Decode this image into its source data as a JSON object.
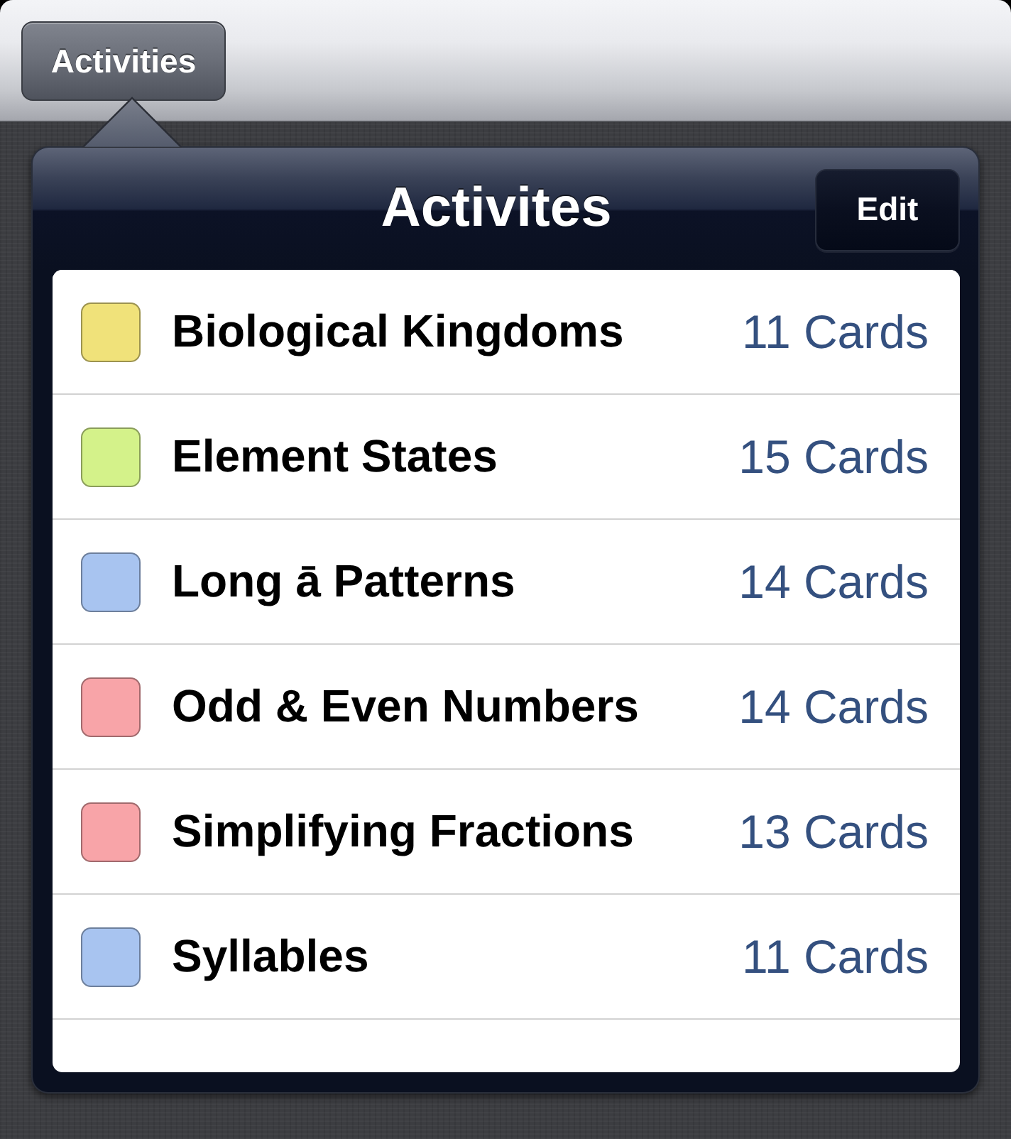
{
  "toolbar": {
    "button": "Activities"
  },
  "popover": {
    "title": "Activites",
    "edit_button": "Edit",
    "items": [
      {
        "name": "Biological Kingdoms",
        "count": "11 Cards",
        "color": "#f0e27a"
      },
      {
        "name": "Element States",
        "count": "15 Cards",
        "color": "#d4f28a"
      },
      {
        "name": "Long ā Patterns",
        "count": "14 Cards",
        "color": "#a8c4f0"
      },
      {
        "name": "Odd & Even Numbers",
        "count": "14 Cards",
        "color": "#f8a4a8"
      },
      {
        "name": "Simplifying Fractions",
        "count": "13 Cards",
        "color": "#f8a4a8"
      },
      {
        "name": "Syllables",
        "count": "11 Cards",
        "color": "#a8c4f0"
      }
    ]
  }
}
